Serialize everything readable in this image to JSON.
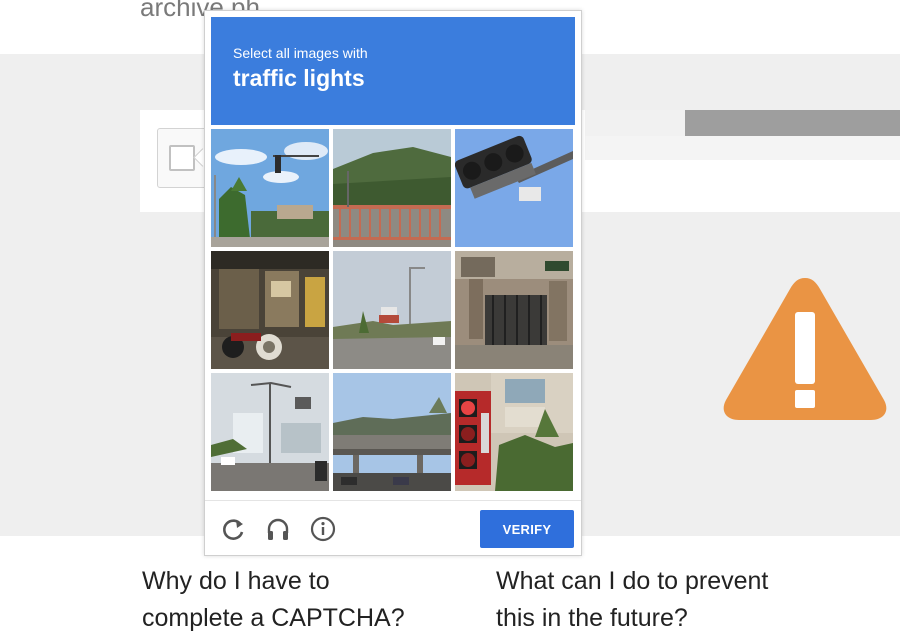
{
  "page": {
    "top_text": "archive.ph",
    "faq_left_line1": "Why do I have to",
    "faq_left_line2": "complete a CAPTCHA?",
    "faq_right_line1": "What can I do to prevent",
    "faq_right_line2": "this in the future?"
  },
  "captcha": {
    "instruction": "Select all images with",
    "target": "traffic lights",
    "verify_label": "VERIFY",
    "header_color": "#3b7ddd",
    "button_color": "#2f6fdc",
    "tiles": [
      {
        "scene": "street-with-traffic-light"
      },
      {
        "scene": "bridge-railing-hillside"
      },
      {
        "scene": "traffic-light-closeup"
      },
      {
        "scene": "shop-with-motorcycle"
      },
      {
        "scene": "road-with-signs"
      },
      {
        "scene": "house-gate-street-sign"
      },
      {
        "scene": "street-poles-buildings"
      },
      {
        "scene": "overpass-cars"
      },
      {
        "scene": "red-traffic-light-building"
      }
    ],
    "footer_icons": [
      "reload-icon",
      "audio-headphones-icon",
      "info-icon"
    ]
  },
  "warning": {
    "icon": "warning-triangle-icon",
    "color": "#ea9444"
  }
}
